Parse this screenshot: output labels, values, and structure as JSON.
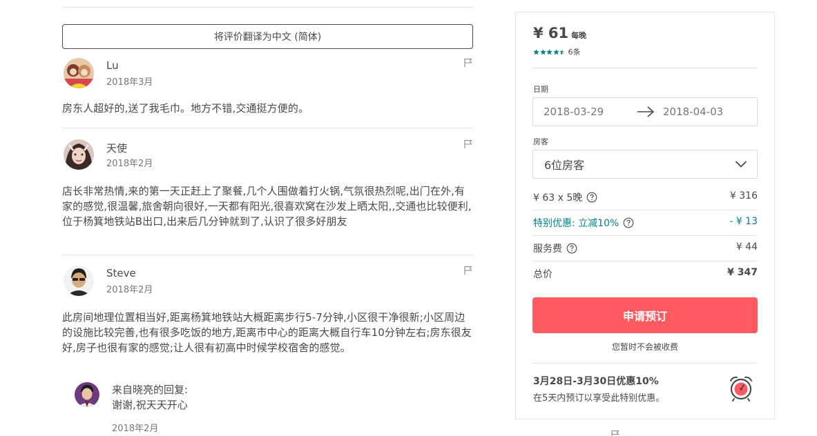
{
  "reviews_section": {
    "translate_label": "将评价翻译为中文 (简体)",
    "reviews": [
      {
        "name": "Lu",
        "date": "2018年3月",
        "text": "房东人超好的,送了我毛巾。地方不错,交通挺方便的。"
      },
      {
        "name": "天使",
        "date": "2018年2月",
        "text": "店长非常热情,来的第一天正赶上了聚餐,几个人围做着打火锅,气氛很热烈呢,出门在外,有家的感觉,很温馨,旅舍朝向很好,一天都有阳光,很喜欢窝在沙发上晒太阳,,交通也比较便利,位于杨箕地铁站B出口,出来后几分钟就到了,认识了很多好朋友"
      },
      {
        "name": "Steve",
        "date": "2018年2月",
        "text": "此房间地理位置相当好,距离杨箕地铁站大概距离步行5-7分钟,小区很干净很新;小区周边的设施比较完善,也有很多吃饭的地方,距离市中心的距离大概自行车10分钟左右;房东很友好,房子也很有家的感觉;让人很有初高中时候学校宿舍的感觉。",
        "reply": {
          "title": "来自晓亮的回复:",
          "text": "谢谢,祝天天开心",
          "date": "2018年2月"
        }
      }
    ]
  },
  "booking": {
    "price": "¥ 61",
    "per_night": "每晚",
    "rating": 4.5,
    "rating_count": "6条",
    "dates_label": "日期",
    "check_in": "2018-03-29",
    "check_out": "2018-04-03",
    "guests_label": "房客",
    "guests_value": "6位房客",
    "lines": {
      "nights_label": "¥ 63 x 5晚",
      "nights_value": "¥ 316",
      "discount_label": "特别优惠: 立减10%",
      "discount_value": "- ¥ 13",
      "service_label": "服务费",
      "service_value": "¥ 44",
      "total_label": "总价",
      "total_value": "¥ 347"
    },
    "book_button": "申请预订",
    "no_charge": "您暂时不会被收费",
    "promo_title": "3月28日-3月30日优惠10%",
    "promo_desc": "在5天内预订以享受此特别优惠。"
  },
  "colors": {
    "accent": "#ff5a5f",
    "teal": "#008489",
    "text": "#484848",
    "muted": "#767676",
    "border": "#e4e4e4"
  }
}
